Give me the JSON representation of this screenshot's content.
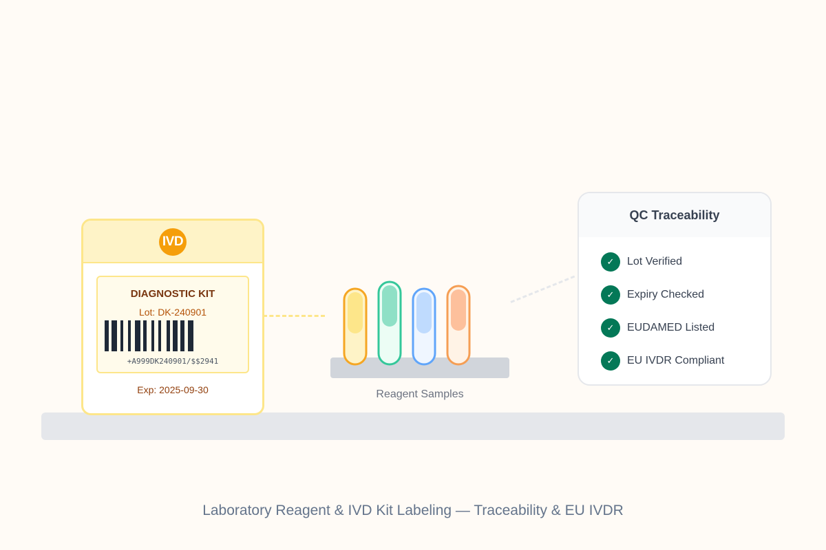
{
  "kit": {
    "badge": "IVD",
    "title": "DIAGNOSTIC KIT",
    "lot": "Lot: DK-240901",
    "barcode_text": "+A999DK240901/$$2941",
    "expiry": "Exp: 2025-09-30"
  },
  "samples": {
    "caption": "Reagent Samples",
    "tubes": [
      {
        "name": "tube-amber",
        "stroke": "#f5a623",
        "fill_light": "#fef3c7",
        "fill_dark": "#fde68a"
      },
      {
        "name": "tube-teal",
        "stroke": "#34c79a",
        "fill_light": "#ecfdf5",
        "fill_dark": "#8fe0c6"
      },
      {
        "name": "tube-blue",
        "stroke": "#60a5fa",
        "fill_light": "#eff6ff",
        "fill_dark": "#bfdbfe"
      },
      {
        "name": "tube-orange",
        "stroke": "#f59e54",
        "fill_light": "#fff3e6",
        "fill_dark": "#fdc09c"
      }
    ]
  },
  "qc": {
    "title": "QC Traceability",
    "items": [
      {
        "label": "Lot Verified",
        "icon": "check-icon"
      },
      {
        "label": "Expiry Checked",
        "icon": "check-icon"
      },
      {
        "label": "EUDAMED Listed",
        "icon": "check-icon"
      },
      {
        "label": "EU IVDR Compliant",
        "icon": "check-icon"
      }
    ]
  },
  "caption": "Laboratory Reagent & IVD Kit Labeling — Traceability & EU IVDR",
  "colors": {
    "background": "#fffbf6",
    "kit_border": "#fde68a",
    "kit_accent": "#f59e0b",
    "check_green": "#047857"
  }
}
